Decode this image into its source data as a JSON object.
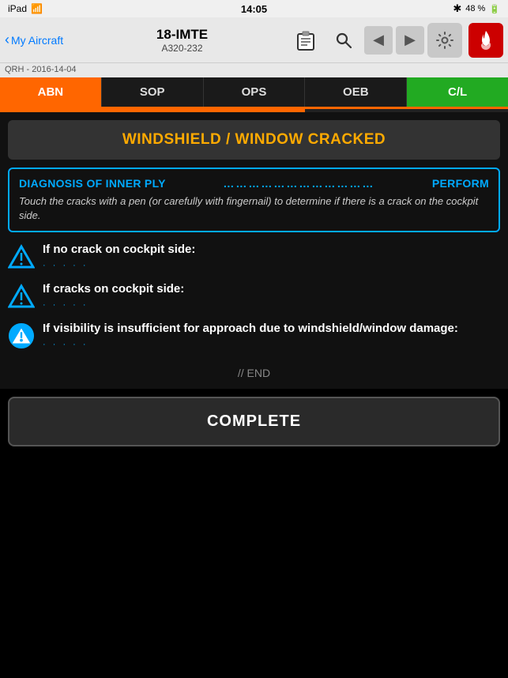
{
  "statusBar": {
    "device": "iPad",
    "wifi": "wifi-icon",
    "time": "14:05",
    "bluetooth": "✱",
    "battery_pct": "48 %",
    "battery_icon": "battery-icon"
  },
  "header": {
    "back_label": "My Aircraft",
    "aircraft_id": "18-IMTE",
    "aircraft_type": "A320-232",
    "clipboard_icon": "clipboard-icon",
    "search_icon": "search-icon",
    "nav_left_icon": "nav-left-icon",
    "nav_right_icon": "nav-right-icon",
    "gear_icon": "gear-icon",
    "red_icon": "fire-icon"
  },
  "qrh": {
    "label": "QRH - 2016-14-04"
  },
  "tabs": [
    {
      "id": "abn",
      "label": "ABN",
      "state": "active-abn"
    },
    {
      "id": "sop",
      "label": "SOP",
      "state": ""
    },
    {
      "id": "ops",
      "label": "OPS",
      "state": ""
    },
    {
      "id": "oeb",
      "label": "OEB",
      "state": ""
    },
    {
      "id": "cl",
      "label": "C/L",
      "state": "active-cl"
    }
  ],
  "main": {
    "title": "WINDSHIELD / WINDOW CRACKED",
    "diagnosis": {
      "header_left": "DIAGNOSIS OF INNER PLY",
      "header_dots": "………………………………………",
      "header_right": "PERFORM",
      "subtitle": "Touch the cracks with a pen (or carefully with fingernail) to determine if there is a crack on the cockpit side."
    },
    "conditions": [
      {
        "id": "no-crack",
        "icon_type": "outline",
        "label": "If no crack on cockpit side:"
      },
      {
        "id": "crack",
        "icon_type": "outline",
        "label": "If cracks on cockpit side:"
      },
      {
        "id": "visibility",
        "icon_type": "filled",
        "label": "If visibility is insufficient for approach due to windshield/window damage:"
      }
    ],
    "end_label": "// END",
    "complete_button": "COMPLETE"
  }
}
